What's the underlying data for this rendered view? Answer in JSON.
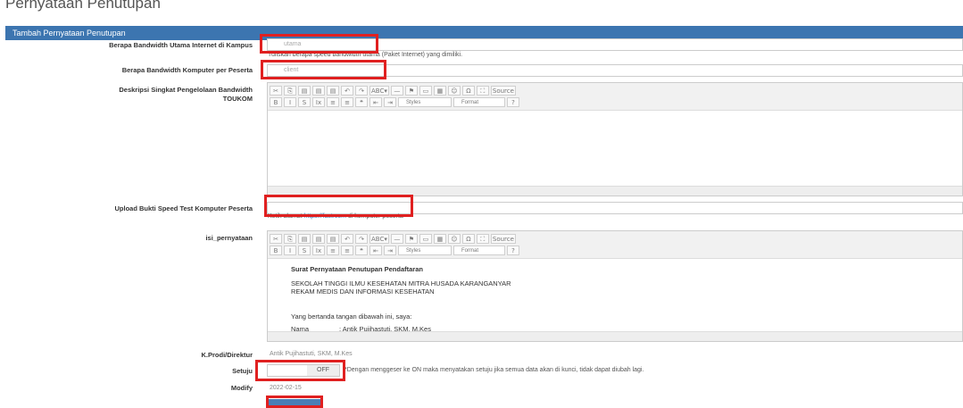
{
  "page_title": "Pernyataan Penutupan",
  "panel_title": "Tambah Pernyataan Penutupan",
  "fields": {
    "bandwidth_main": {
      "label": "Berapa Bandwidth Utama Internet di Kampus",
      "placeholder": "utama",
      "help": "Tuliskan berapa speed bandwidth utama (Paket Internet) yang dimiliki."
    },
    "bandwidth_per_user": {
      "label": "Berapa Bandwidth Komputer per Peserta",
      "placeholder": "client"
    },
    "description": {
      "label_line1": "Deskripsi Singkat Pengelolaan Bandwidth",
      "label_line2": "TOUKOM"
    },
    "upload": {
      "label": "Upload Bukti Speed Test Komputer Peserta",
      "help_prefix": "Ketik alamat",
      "help_link": "https://fast.com",
      "help_suffix": "di komputer peserta"
    },
    "statement": {
      "label": "isi_pernyataan",
      "doc_title": "Surat Pernyataan Penutupan Pendaftaran",
      "doc_line1": "SEKOLAH TINGGI ILMU KESEHATAN MITRA HUSADA KARANGANYAR",
      "doc_line2": "REKAM MEDIS DAN INFORMASI KESEHATAN",
      "doc_line3": "Yang bertanda tangan dibawah ini, saya:",
      "doc_name_label": "Nama",
      "doc_name_value": ": Antik Pujihastuti, SKM, M.Kes"
    },
    "kprodi": {
      "label": "K.Prodi/Direktur",
      "value": "Antik Pujihastuti, SKM, M.Kes"
    },
    "agree": {
      "label": "Setuju",
      "toggle_text": "OFF",
      "note": "*Dengan menggeser ke ON maka menyatakan setuju jika semua data akan di kunci, tidak dapat diubah lagi."
    },
    "modify": {
      "label": "Modify",
      "value": "2022-02-15"
    }
  },
  "editor_toolbar": {
    "row1": [
      "✂",
      "⎘",
      "▤",
      "▤",
      "▤",
      "↶",
      "↷",
      "ABC▾",
      "—",
      "⚑",
      "▭",
      "▦",
      "☺",
      "Ω",
      "⛶",
      "Source"
    ],
    "row2": [
      "B",
      "I",
      "S",
      "Ix",
      "≡",
      "≡",
      "❝",
      "⇤",
      "⇥"
    ],
    "styles": "Styles",
    "format": "Format",
    "help": "?"
  }
}
